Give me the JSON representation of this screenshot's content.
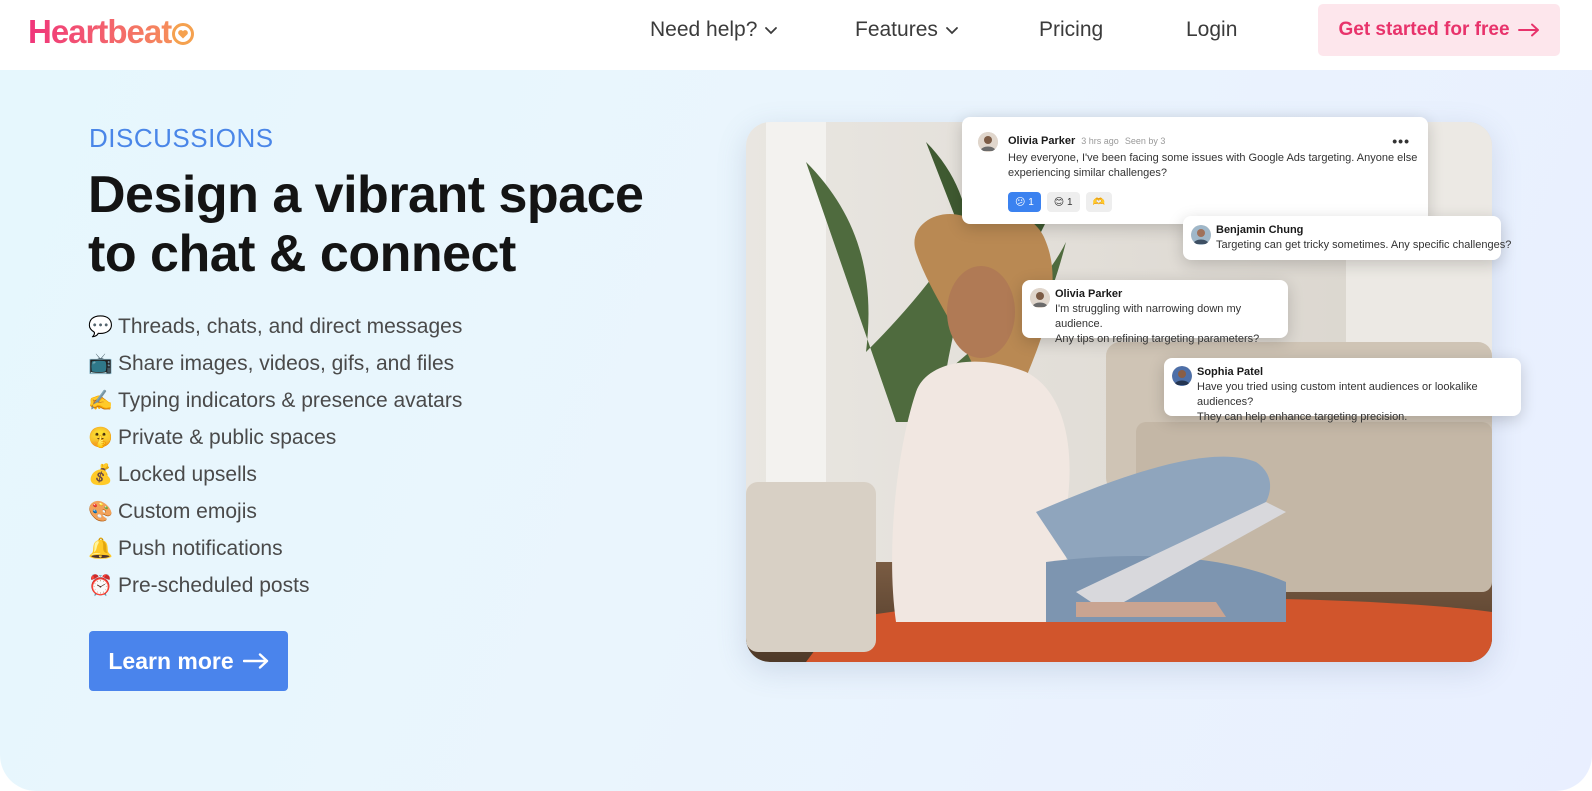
{
  "brand": {
    "name": "Heartbeat",
    "logo_text": "Heartbeat"
  },
  "nav": {
    "items": [
      {
        "label": "Need help?",
        "dropdown": true
      },
      {
        "label": "Features",
        "dropdown": true
      },
      {
        "label": "Pricing",
        "dropdown": false
      },
      {
        "label": "Login",
        "dropdown": false
      }
    ],
    "cta_label": "Get started for free"
  },
  "hero": {
    "eyebrow": "DISCUSSIONS",
    "headline_line1": "Design a vibrant space",
    "headline_line2": "to chat & connect",
    "features": [
      {
        "emoji": "💬",
        "text": "Threads, chats, and direct messages"
      },
      {
        "emoji": "📺",
        "text": "Share images, videos, gifs, and files"
      },
      {
        "emoji": "✍️",
        "text": "Typing indicators & presence avatars"
      },
      {
        "emoji": "🤫",
        "text": "Private & public spaces"
      },
      {
        "emoji": "💰",
        "text": "Locked upsells"
      },
      {
        "emoji": "🎨",
        "text": "Custom emojis"
      },
      {
        "emoji": "🔔",
        "text": "Push notifications"
      },
      {
        "emoji": "⏰",
        "text": "Pre-scheduled posts"
      }
    ],
    "learn_more_label": "Learn more"
  },
  "chat": {
    "post": {
      "author": "Olivia Parker",
      "time": "3 hrs ago",
      "seen": "Seen by 3",
      "text_line1": "Hey everyone, I've been facing some issues with Google Ads targeting. Anyone else",
      "text_line2": "experiencing similar challenges?",
      "reactions": [
        {
          "emoji": "😕",
          "count": "1",
          "active": true
        },
        {
          "emoji": "😊",
          "count": "1",
          "active": false
        },
        {
          "emoji": "🫶",
          "count": "",
          "active": false
        }
      ]
    },
    "replies": [
      {
        "author": "Benjamin Chung",
        "line1": "Targeting can get tricky sometimes. Any specific challenges?",
        "line2": ""
      },
      {
        "author": "Olivia Parker",
        "line1": "I'm struggling with narrowing down my audience.",
        "line2": "Any tips on refining targeting parameters?"
      },
      {
        "author": "Sophia Patel",
        "line1": "Have you tried using custom intent audiences or lookalike audiences?",
        "line2": "They can help enhance targeting precision."
      }
    ]
  },
  "colors": {
    "brand_pink": "#f0357b",
    "brand_orange": "#f79d54",
    "accent_blue": "#4a84ec",
    "cta_bg": "#fde6ec",
    "cta_text": "#e8336b"
  },
  "icons": {
    "nav_dropdown": "chevron-down-icon",
    "arrow": "arrow-right-icon",
    "menu": "more-horizontal-icon",
    "logo_mark": "heart-icon"
  }
}
